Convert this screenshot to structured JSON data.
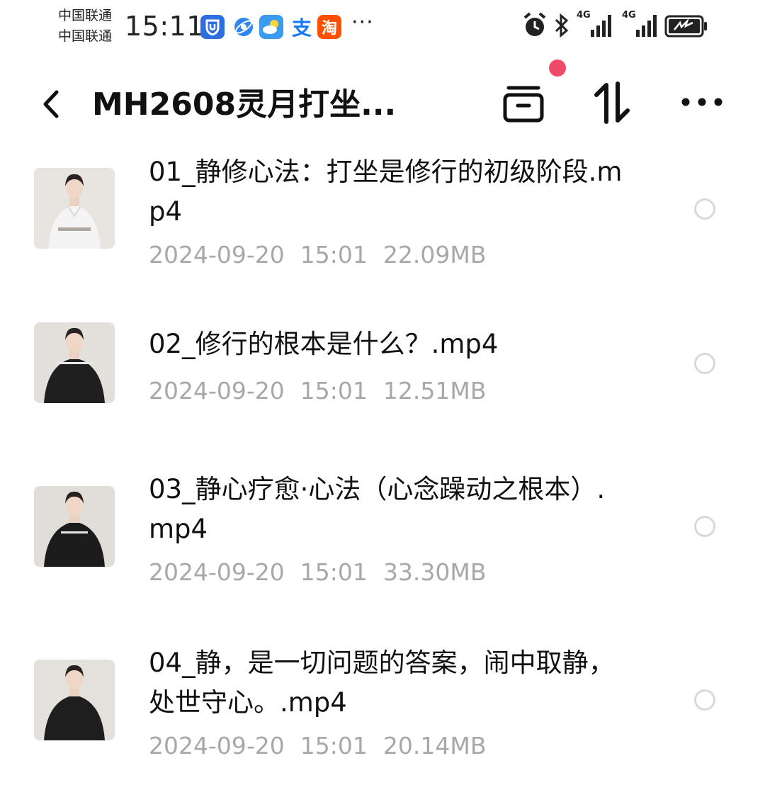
{
  "status_bar": {
    "carrier_1": "中国联通",
    "carrier_2": "中国联通",
    "time": "15:11",
    "apps": [
      "shield-app-icon",
      "browser-app-icon",
      "weather-app-icon",
      "alipay-app-icon",
      "taobao-app-icon"
    ],
    "alipay_glyph": "支",
    "taobao_glyph": "淘",
    "more_indicator": "···",
    "network_label_1": "4G",
    "network_label_2": "4G"
  },
  "header": {
    "back_icon": "chevron-left-icon",
    "title": "MH2608灵月打坐...",
    "actions": [
      "archive-icon",
      "sort-icon",
      "more-icon"
    ],
    "accent_color": "#f04a6a"
  },
  "files": [
    {
      "name": "01_静修心法：打坐是修行的初级阶段.mp4",
      "date": "2024-09-20",
      "time": "15:01",
      "size": "22.09MB",
      "shirt": "white"
    },
    {
      "name": "02_修行的根本是什么？.mp4",
      "date": "2024-09-20",
      "time": "15:01",
      "size": "12.51MB",
      "shirt": "black"
    },
    {
      "name": "03_静心疗愈·心法（心念躁动之根本）.mp4",
      "date": "2024-09-20",
      "time": "15:01",
      "size": "33.30MB",
      "shirt": "black"
    },
    {
      "name": "04_静，是一切问题的答案，闹中取静，处世守心。.mp4",
      "date": "2024-09-20",
      "time": "15:01",
      "size": "20.14MB",
      "shirt": "black"
    }
  ],
  "colors": {
    "meta_text": "#a8a8a8",
    "radio_border": "#d9d9d9"
  }
}
